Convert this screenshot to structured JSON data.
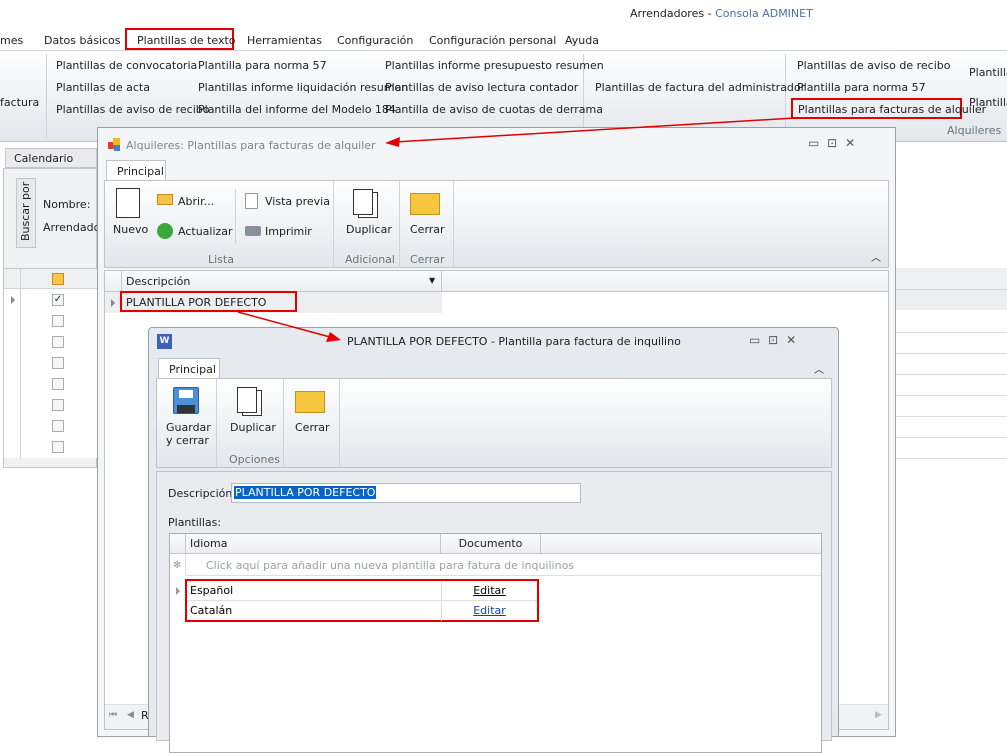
{
  "app": {
    "title_prefix": "Arrendadores - ",
    "title_app": "Consola ADMINET"
  },
  "menu": [
    "mes",
    "Datos básicos",
    "Plantillas de texto",
    "Herramientas",
    "Configuración",
    "Configuración personal",
    "Ayuda"
  ],
  "ribbon": {
    "left_partial": "factura",
    "col1": [
      "Plantillas de convocatoria",
      "Plantillas de acta",
      "Plantillas de aviso de recibo"
    ],
    "col2": [
      "Plantilla para norma 57",
      "Plantillas informe liquidación resumen",
      "Plantilla del informe del Modelo 184"
    ],
    "col3": [
      "Plantillas informe presupuesto resumen",
      "Plantillas de aviso lectura contador",
      "Plantilla de aviso de cuotas de derrama"
    ],
    "col4": "Plantillas de factura del administrador",
    "col5": [
      "Plantillas de aviso de recibo",
      "Plantilla para norma 57",
      "Plantillas para facturas de alquiler"
    ],
    "col6": [
      "Plantilla",
      "Plantilla"
    ],
    "group_alquileres": "Alquileres"
  },
  "left": {
    "tab": "Calendario",
    "buscar_por": "Buscar por",
    "nombre": "Nombre:",
    "arrendador": "Arrendador"
  },
  "win1": {
    "title": "Alquileres: Plantillas para facturas de alquiler",
    "tab": "Principal",
    "buttons": {
      "nuevo": "Nuevo",
      "abrir": "Abrir...",
      "actualizar": "Actualizar",
      "vista_previa": "Vista previa",
      "imprimir": "Imprimir",
      "duplicar": "Duplicar",
      "cerrar": "Cerrar"
    },
    "groups": {
      "lista": "Lista",
      "adicional": "Adicional",
      "cerrar": "Cerrar"
    },
    "grid": {
      "column": "Descripción",
      "rows": [
        "PLANTILLA POR DEFECTO"
      ]
    },
    "nav_partial": "R"
  },
  "win2": {
    "title": "PLANTILLA POR DEFECTO - Plantilla para factura de inquilino",
    "tab": "Principal",
    "buttons": {
      "guardar1": "Guardar",
      "guardar2": "y cerrar",
      "duplicar": "Duplicar",
      "cerrar": "Cerrar"
    },
    "groups": {
      "opciones": "Opciones"
    },
    "descripcion_label": "Descripción:",
    "descripcion_value": "PLANTILLA POR DEFECTO",
    "plantillas_label": "Plantillas:",
    "grid": {
      "columns": [
        "Idioma",
        "Documento"
      ],
      "new_row": "Click aquí para añadir una nueva plantilla para fatura de inquilinos",
      "rows": [
        {
          "idioma": "Español",
          "documento": "Editar"
        },
        {
          "idioma": "Catalán",
          "documento": "Editar"
        }
      ]
    }
  },
  "colors": {
    "highlight": "#e00000",
    "accent": "#4a6fa5",
    "selection": "#0a64c8"
  }
}
